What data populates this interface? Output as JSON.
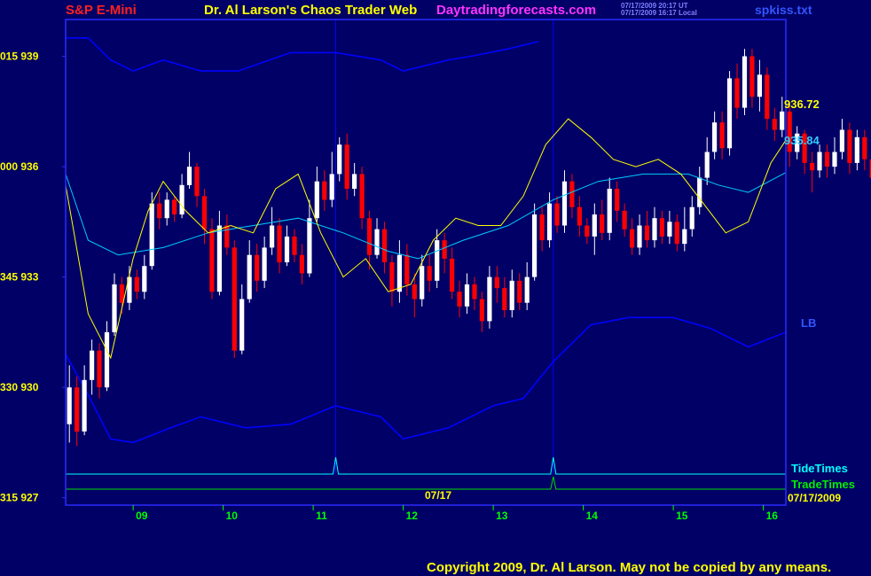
{
  "header": {
    "left_label": "S&P E-Mini",
    "title": "Dr. Al Larson's Chaos Trader Web",
    "site": "Daytradingforecasts.com",
    "stamp_line1": "07/17/2009 20:17 UT",
    "stamp_line2": "07/17/2009 16:17 Local",
    "filename": "spkiss.txt"
  },
  "copyright": "Copyright 2009, Dr. Al Larson. May not be copied by any means.",
  "labels": {
    "last_price": "936.72",
    "ma_value": "935.84",
    "lb": "LB",
    "tide_times": "TideTimes",
    "trade_times": "TradeTimes",
    "session_date": "07/17",
    "date_footer": "07/17/2009"
  },
  "colors": {
    "background": "#000066",
    "frame": "#2a2aff",
    "up_candle": "#ffffff",
    "down_candle": "#ff0000",
    "fast_ma": "#ffff00",
    "slow_ma": "#00ccff",
    "bands": "#0000ff",
    "tide": "#00ffff",
    "trade": "#00dd00",
    "axis_text": "#ffff00",
    "time_text": "#00ff00",
    "title_text": "#ffff00",
    "site_text": "#ff33ff",
    "left_label_text": "#ff0000"
  },
  "chart_data": {
    "type": "candlestick",
    "x_axis": {
      "type": "time",
      "range": [
        "08:15",
        "16:15"
      ],
      "tick_labels": [
        "09",
        "10",
        "11",
        "12",
        "13",
        "14",
        "15",
        "16"
      ]
    },
    "y_axis": {
      "range": [
        926.8,
        940.0
      ],
      "ticks": [
        {
          "value": 939,
          "label": "015  939"
        },
        {
          "value": 936,
          "label": "000  936"
        },
        {
          "value": 933,
          "label": "345  933"
        },
        {
          "value": 930,
          "label": "330  930"
        },
        {
          "value": 927,
          "label": "315  927"
        }
      ]
    },
    "vertical_markers": [
      "11:15",
      "13:40"
    ],
    "fast_ma": [
      [
        "08:15",
        935.5
      ],
      [
        "08:30",
        932.0
      ],
      [
        "08:45",
        930.8
      ],
      [
        "09:00",
        933.5
      ],
      [
        "09:10",
        934.8
      ],
      [
        "09:20",
        935.6
      ],
      [
        "09:35",
        934.8
      ],
      [
        "09:50",
        934.2
      ],
      [
        "10:05",
        934.4
      ],
      [
        "10:20",
        934.2
      ],
      [
        "10:35",
        935.4
      ],
      [
        "10:50",
        935.8
      ],
      [
        "11:05",
        934.2
      ],
      [
        "11:20",
        933.0
      ],
      [
        "11:35",
        933.5
      ],
      [
        "11:50",
        932.6
      ],
      [
        "12:05",
        932.8
      ],
      [
        "12:20",
        934.0
      ],
      [
        "12:35",
        934.6
      ],
      [
        "12:50",
        934.4
      ],
      [
        "13:05",
        934.4
      ],
      [
        "13:20",
        935.2
      ],
      [
        "13:35",
        936.6
      ],
      [
        "13:50",
        937.3
      ],
      [
        "14:05",
        936.8
      ],
      [
        "14:20",
        936.2
      ],
      [
        "14:35",
        936.0
      ],
      [
        "14:50",
        936.2
      ],
      [
        "15:05",
        935.8
      ],
      [
        "15:20",
        935.0
      ],
      [
        "15:35",
        934.2
      ],
      [
        "15:50",
        934.5
      ],
      [
        "16:05",
        936.1
      ],
      [
        "16:15",
        936.72
      ]
    ],
    "slow_ma": [
      [
        "08:15",
        935.8
      ],
      [
        "08:30",
        934.0
      ],
      [
        "08:50",
        933.6
      ],
      [
        "09:20",
        933.8
      ],
      [
        "09:50",
        934.2
      ],
      [
        "10:20",
        934.4
      ],
      [
        "10:50",
        934.6
      ],
      [
        "11:20",
        934.2
      ],
      [
        "11:50",
        933.7
      ],
      [
        "12:10",
        933.5
      ],
      [
        "12:40",
        934.0
      ],
      [
        "13:10",
        934.4
      ],
      [
        "13:40",
        935.1
      ],
      [
        "14:10",
        935.6
      ],
      [
        "14:40",
        935.8
      ],
      [
        "15:10",
        935.8
      ],
      [
        "15:30",
        935.5
      ],
      [
        "15:50",
        935.3
      ],
      [
        "16:15",
        935.84
      ]
    ],
    "upper_band": [
      [
        "08:15",
        939.5
      ],
      [
        "08:30",
        939.5
      ],
      [
        "08:45",
        938.9
      ],
      [
        "09:00",
        938.6
      ],
      [
        "09:20",
        938.9
      ],
      [
        "09:45",
        938.6
      ],
      [
        "10:10",
        938.6
      ],
      [
        "10:45",
        939.1
      ],
      [
        "11:15",
        939.1
      ],
      [
        "11:45",
        938.9
      ],
      [
        "12:00",
        938.6
      ],
      [
        "12:30",
        938.9
      ],
      [
        "12:45",
        939.0
      ],
      [
        "13:10",
        939.2
      ],
      [
        "13:30",
        939.4
      ]
    ],
    "lower_band": [
      [
        "08:15",
        930.9
      ],
      [
        "08:30",
        929.8
      ],
      [
        "08:45",
        928.6
      ],
      [
        "09:00",
        928.5
      ],
      [
        "09:25",
        928.9
      ],
      [
        "09:45",
        929.2
      ],
      [
        "10:15",
        928.9
      ],
      [
        "10:45",
        929.0
      ],
      [
        "11:15",
        929.5
      ],
      [
        "11:45",
        929.2
      ],
      [
        "12:00",
        928.6
      ],
      [
        "12:30",
        928.9
      ],
      [
        "13:00",
        929.5
      ],
      [
        "13:20",
        929.7
      ],
      [
        "13:40",
        930.7
      ],
      [
        "14:05",
        931.7
      ],
      [
        "14:30",
        931.9
      ],
      [
        "15:00",
        931.9
      ],
      [
        "15:25",
        931.6
      ],
      [
        "15:50",
        931.1
      ],
      [
        "16:15",
        931.5
      ]
    ],
    "tide_spikes": [
      "11:15",
      "13:40"
    ],
    "trade_spikes": [
      "13:40"
    ],
    "candles": [
      [
        929.0,
        930.0,
        928.5,
        930.6
      ],
      [
        930.0,
        928.8,
        928.4,
        930.3
      ],
      [
        928.8,
        930.2,
        928.7,
        930.6
      ],
      [
        930.2,
        931.0,
        929.8,
        931.3
      ],
      [
        931.0,
        930.0,
        929.7,
        931.2
      ],
      [
        930.0,
        931.5,
        929.9,
        931.8
      ],
      [
        931.5,
        932.8,
        931.4,
        933.1
      ],
      [
        932.8,
        932.3,
        932.0,
        933.0
      ],
      [
        932.3,
        933.0,
        932.1,
        933.3
      ],
      [
        933.0,
        932.6,
        932.4,
        933.2
      ],
      [
        932.6,
        933.3,
        932.4,
        933.6
      ],
      [
        933.3,
        935.0,
        933.2,
        935.3
      ],
      [
        935.0,
        934.6,
        934.3,
        935.3
      ],
      [
        934.6,
        935.1,
        934.4,
        935.3
      ],
      [
        935.1,
        934.7,
        934.5,
        935.2
      ],
      [
        934.7,
        935.5,
        934.6,
        935.8
      ],
      [
        935.5,
        936.0,
        935.4,
        936.4
      ],
      [
        936.0,
        935.2,
        934.9,
        936.1
      ],
      [
        935.2,
        934.3,
        933.9,
        935.4
      ],
      [
        934.3,
        932.6,
        932.4,
        934.6
      ],
      [
        932.6,
        934.4,
        932.5,
        934.8
      ],
      [
        934.4,
        933.8,
        933.6,
        934.7
      ],
      [
        933.8,
        931.0,
        930.8,
        934.0
      ],
      [
        931.0,
        932.4,
        930.9,
        932.8
      ],
      [
        932.4,
        933.6,
        932.3,
        934.0
      ],
      [
        933.6,
        932.9,
        932.6,
        933.9
      ],
      [
        932.9,
        933.8,
        932.7,
        934.1
      ],
      [
        933.8,
        934.4,
        933.6,
        934.9
      ],
      [
        934.4,
        933.4,
        933.1,
        934.6
      ],
      [
        933.4,
        934.1,
        933.3,
        934.4
      ],
      [
        934.1,
        933.6,
        933.4,
        934.3
      ],
      [
        933.6,
        933.1,
        932.8,
        933.9
      ],
      [
        933.1,
        934.6,
        933.0,
        935.1
      ],
      [
        934.6,
        935.6,
        934.5,
        936.0
      ],
      [
        935.6,
        935.1,
        934.8,
        935.9
      ],
      [
        935.1,
        935.8,
        934.9,
        936.4
      ],
      [
        935.8,
        936.6,
        935.6,
        936.8
      ],
      [
        936.6,
        935.4,
        935.1,
        936.9
      ],
      [
        935.4,
        935.8,
        935.2,
        936.1
      ],
      [
        935.8,
        934.6,
        934.3,
        936.0
      ],
      [
        934.6,
        933.6,
        933.2,
        934.8
      ],
      [
        933.6,
        934.3,
        933.5,
        934.6
      ],
      [
        934.3,
        933.4,
        933.1,
        934.5
      ],
      [
        933.4,
        932.6,
        932.2,
        933.6
      ],
      [
        932.6,
        933.6,
        932.3,
        934.0
      ],
      [
        933.6,
        932.8,
        932.5,
        933.9
      ],
      [
        932.8,
        932.4,
        931.9,
        933.1
      ],
      [
        932.4,
        933.3,
        932.2,
        933.6
      ],
      [
        933.3,
        932.9,
        932.6,
        933.6
      ],
      [
        932.9,
        934.0,
        932.7,
        934.3
      ],
      [
        934.0,
        933.5,
        933.1,
        934.2
      ],
      [
        933.5,
        932.6,
        932.4,
        933.8
      ],
      [
        932.6,
        932.2,
        931.9,
        932.9
      ],
      [
        932.2,
        932.8,
        932.0,
        933.1
      ],
      [
        932.8,
        932.4,
        932.1,
        933.0
      ],
      [
        932.4,
        931.8,
        931.5,
        932.6
      ],
      [
        931.8,
        933.0,
        931.6,
        933.3
      ],
      [
        933.0,
        932.7,
        932.3,
        933.3
      ],
      [
        932.7,
        932.1,
        931.9,
        933.0
      ],
      [
        932.1,
        932.9,
        931.9,
        933.2
      ],
      [
        932.9,
        932.3,
        932.1,
        933.1
      ],
      [
        932.3,
        933.0,
        932.1,
        933.4
      ],
      [
        933.0,
        934.7,
        932.9,
        935.0
      ],
      [
        934.7,
        934.0,
        933.7,
        934.9
      ],
      [
        934.0,
        935.0,
        933.8,
        935.3
      ],
      [
        935.0,
        934.4,
        934.2,
        935.2
      ],
      [
        934.4,
        935.6,
        934.2,
        935.9
      ],
      [
        935.6,
        934.9,
        934.6,
        935.8
      ],
      [
        934.9,
        934.4,
        934.1,
        935.2
      ],
      [
        934.4,
        934.1,
        933.9,
        934.6
      ],
      [
        934.1,
        934.7,
        933.6,
        935.0
      ],
      [
        934.7,
        934.2,
        934.0,
        935.1
      ],
      [
        934.2,
        935.4,
        934.0,
        935.7
      ],
      [
        935.4,
        934.8,
        934.5,
        935.6
      ],
      [
        934.8,
        934.3,
        934.1,
        935.0
      ],
      [
        934.3,
        933.8,
        933.6,
        934.6
      ],
      [
        933.8,
        934.4,
        933.6,
        934.7
      ],
      [
        934.4,
        934.0,
        933.8,
        934.8
      ],
      [
        934.0,
        934.6,
        933.8,
        934.9
      ],
      [
        934.6,
        934.1,
        933.9,
        934.8
      ],
      [
        934.1,
        934.5,
        933.9,
        934.8
      ],
      [
        934.5,
        933.9,
        933.7,
        934.7
      ],
      [
        933.9,
        934.3,
        933.7,
        934.9
      ],
      [
        934.3,
        934.9,
        934.1,
        935.2
      ],
      [
        934.9,
        935.7,
        934.7,
        936.0
      ],
      [
        935.7,
        936.4,
        935.5,
        936.8
      ],
      [
        936.4,
        937.2,
        936.2,
        937.5
      ],
      [
        937.2,
        936.5,
        936.2,
        937.5
      ],
      [
        936.5,
        938.4,
        936.3,
        938.6
      ],
      [
        938.4,
        937.6,
        937.3,
        938.8
      ],
      [
        937.6,
        939.0,
        937.4,
        939.2
      ],
      [
        939.0,
        937.9,
        937.6,
        939.2
      ],
      [
        937.9,
        938.5,
        937.5,
        938.9
      ],
      [
        938.5,
        937.3,
        937.0,
        938.7
      ],
      [
        937.3,
        937.0,
        936.7,
        937.6
      ],
      [
        937.0,
        937.5,
        936.8,
        937.9
      ],
      [
        937.5,
        936.4,
        936.0,
        937.7
      ],
      [
        936.4,
        936.9,
        936.2,
        937.1
      ],
      [
        936.9,
        936.1,
        935.8,
        937.0
      ],
      [
        936.1,
        935.9,
        935.3,
        936.4
      ],
      [
        935.9,
        936.4,
        935.7,
        936.6
      ],
      [
        936.4,
        936.0,
        935.7,
        936.6
      ],
      [
        936.0,
        936.4,
        935.8,
        936.8
      ],
      [
        936.4,
        937.0,
        936.2,
        937.3
      ],
      [
        937.0,
        936.1,
        935.8,
        937.2
      ],
      [
        936.1,
        936.8,
        935.9,
        937.0
      ],
      [
        936.8,
        936.2,
        935.9,
        937.0
      ],
      [
        936.2,
        935.7,
        935.4,
        936.4
      ],
      [
        935.7,
        936.4,
        935.5,
        936.8
      ],
      [
        936.4,
        935.8,
        935.5,
        936.6
      ],
      [
        935.8,
        936.5,
        935.6,
        936.9
      ],
      [
        936.5,
        937.0,
        936.3,
        937.2
      ],
      [
        937.0,
        936.0,
        935.7,
        937.2
      ],
      [
        936.0,
        935.1,
        934.8,
        936.3
      ],
      [
        935.1,
        935.6,
        934.9,
        935.9
      ],
      [
        935.6,
        934.8,
        934.5,
        935.8
      ],
      [
        934.8,
        935.2,
        934.5,
        935.5
      ],
      [
        935.2,
        933.7,
        933.4,
        935.4
      ],
      [
        933.7,
        933.0,
        932.8,
        934.1
      ],
      [
        933.0,
        933.8,
        932.7,
        934.1
      ],
      [
        933.8,
        934.6,
        932.7,
        934.9
      ],
      [
        934.6,
        934.2,
        933.8,
        934.9
      ],
      [
        934.2,
        935.6,
        934.0,
        936.0
      ],
      [
        935.6,
        936.3,
        935.4,
        936.6
      ],
      [
        936.3,
        937.2,
        936.1,
        937.4
      ],
      [
        937.2,
        936.5,
        936.2,
        937.4
      ],
      [
        936.5,
        937.4,
        936.3,
        937.8
      ],
      [
        937.4,
        936.72,
        936.4,
        937.6
      ]
    ]
  }
}
